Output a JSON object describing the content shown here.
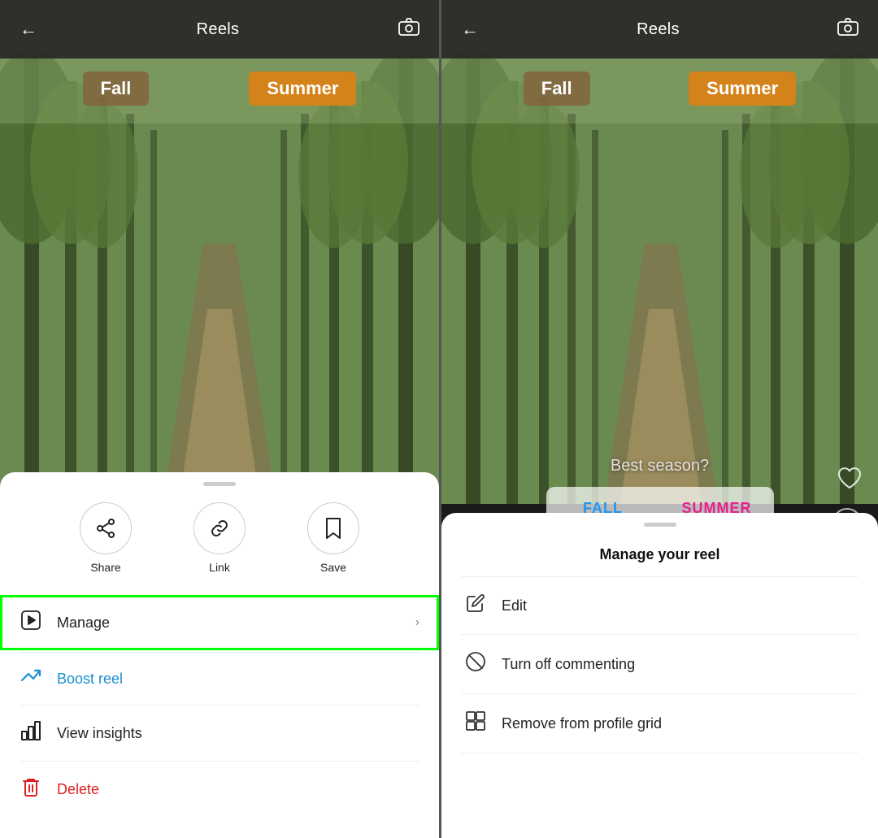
{
  "left_panel": {
    "header": {
      "title": "Reels",
      "back_label": "←",
      "camera_label": "⊙"
    },
    "season_tags": {
      "fall": "Fall",
      "summer": "Summer"
    },
    "bottom_sheet": {
      "actions": [
        {
          "id": "share",
          "icon": "share",
          "label": "Share"
        },
        {
          "id": "link",
          "icon": "link",
          "label": "Link"
        },
        {
          "id": "save",
          "icon": "bookmark",
          "label": "Save"
        }
      ],
      "menu_items": [
        {
          "id": "manage",
          "icon": "▣",
          "text": "Manage",
          "chevron": "›",
          "highlighted": true,
          "color": "default"
        },
        {
          "id": "boost",
          "icon": "↗",
          "text": "Boost reel",
          "chevron": null,
          "color": "blue"
        },
        {
          "id": "insights",
          "icon": "📊",
          "text": "View insights",
          "chevron": null,
          "color": "default"
        },
        {
          "id": "delete",
          "icon": "🗑",
          "text": "Delete",
          "chevron": null,
          "color": "red"
        }
      ]
    }
  },
  "right_panel": {
    "header": {
      "title": "Reels",
      "back_label": "←",
      "camera_label": "⊙"
    },
    "season_tags": {
      "fall": "Fall",
      "summer": "Summer"
    },
    "poll": {
      "question": "Best season?",
      "option1": "FALL",
      "option2": "SUMMER"
    },
    "manage_sheet": {
      "title": "Manage your reel",
      "menu_items": [
        {
          "id": "edit",
          "icon": "✏",
          "text": "Edit"
        },
        {
          "id": "turn-off-commenting",
          "icon": "🚫",
          "text": "Turn off commenting"
        },
        {
          "id": "remove-from-grid",
          "icon": "⊞",
          "text": "Remove from profile grid"
        }
      ]
    }
  }
}
